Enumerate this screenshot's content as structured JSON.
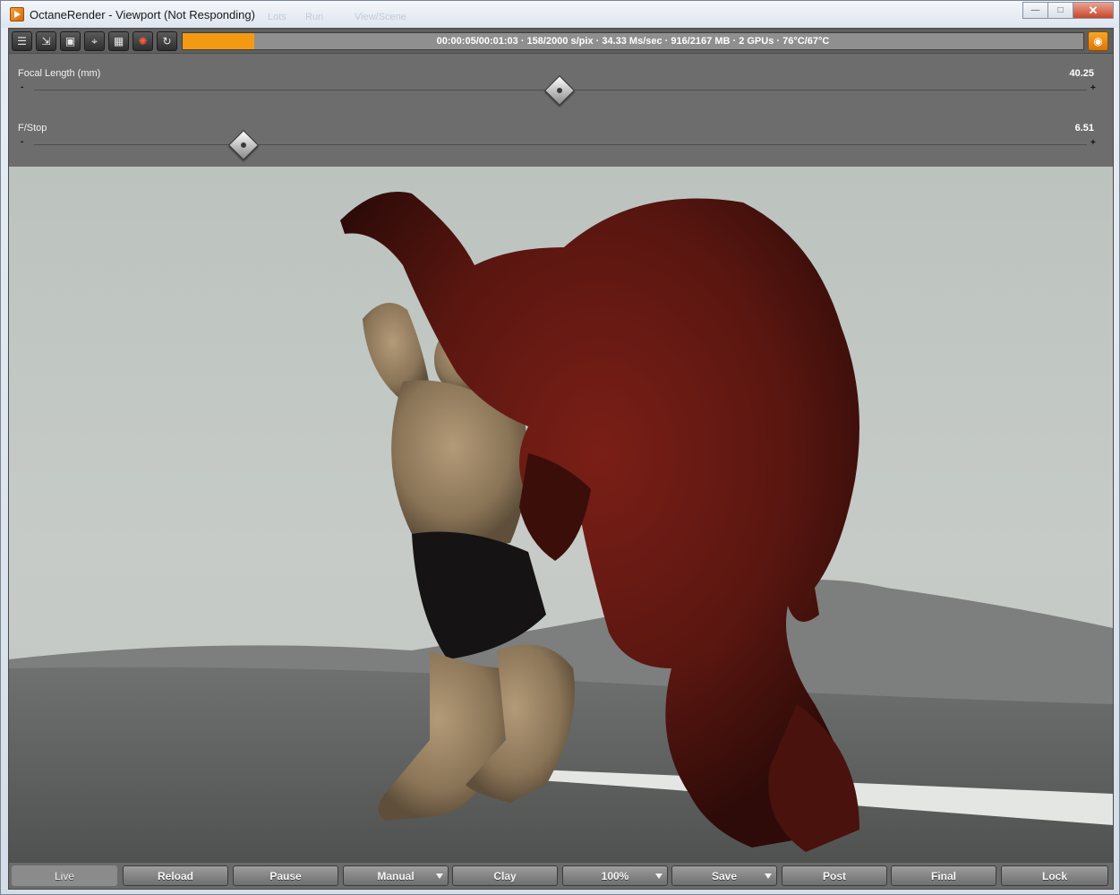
{
  "window": {
    "title": "OctaneRender - Viewport (Not Responding)",
    "background_menu_ghosts": [
      "Lots",
      "Run",
      "View/Scene"
    ],
    "controls": {
      "minimize": "—",
      "maximize": "□",
      "close": "✕"
    }
  },
  "toolbar": {
    "buttons": [
      {
        "name": "node-inspector-icon",
        "glyph": "☰"
      },
      {
        "name": "import-icon",
        "glyph": "⇲"
      },
      {
        "name": "render-region-icon",
        "glyph": "▣"
      },
      {
        "name": "pick-focus-icon",
        "glyph": "⌖"
      },
      {
        "name": "grid-view-icon",
        "glyph": "▦"
      },
      {
        "name": "color-picker-icon",
        "glyph": "✺"
      },
      {
        "name": "refresh-icon",
        "glyph": "↻"
      }
    ],
    "progress": 0.08,
    "status": "00:00:05/00:01:03 · 158/2000 s/pix · 34.33 Ms/sec · 916/2167 MB · 2 GPUs · 76°C/67°C",
    "accent_color": "#f39a12",
    "snapshot_icon": "camera-icon"
  },
  "sliders": [
    {
      "label": "Focal Length (mm)",
      "value": "40.25",
      "position": 0.499
    },
    {
      "label": "F/Stop",
      "value": "6.51",
      "position": 0.199
    }
  ],
  "slider_signs": {
    "minus": "-",
    "plus": "+"
  },
  "bottom_bar": {
    "live": "Live",
    "reload": "Reload",
    "pause": "Pause",
    "manual": "Manual",
    "clay": "Clay",
    "zoom": "100%",
    "save": "Save",
    "post": "Post",
    "final": "Final",
    "lock": "Lock"
  }
}
